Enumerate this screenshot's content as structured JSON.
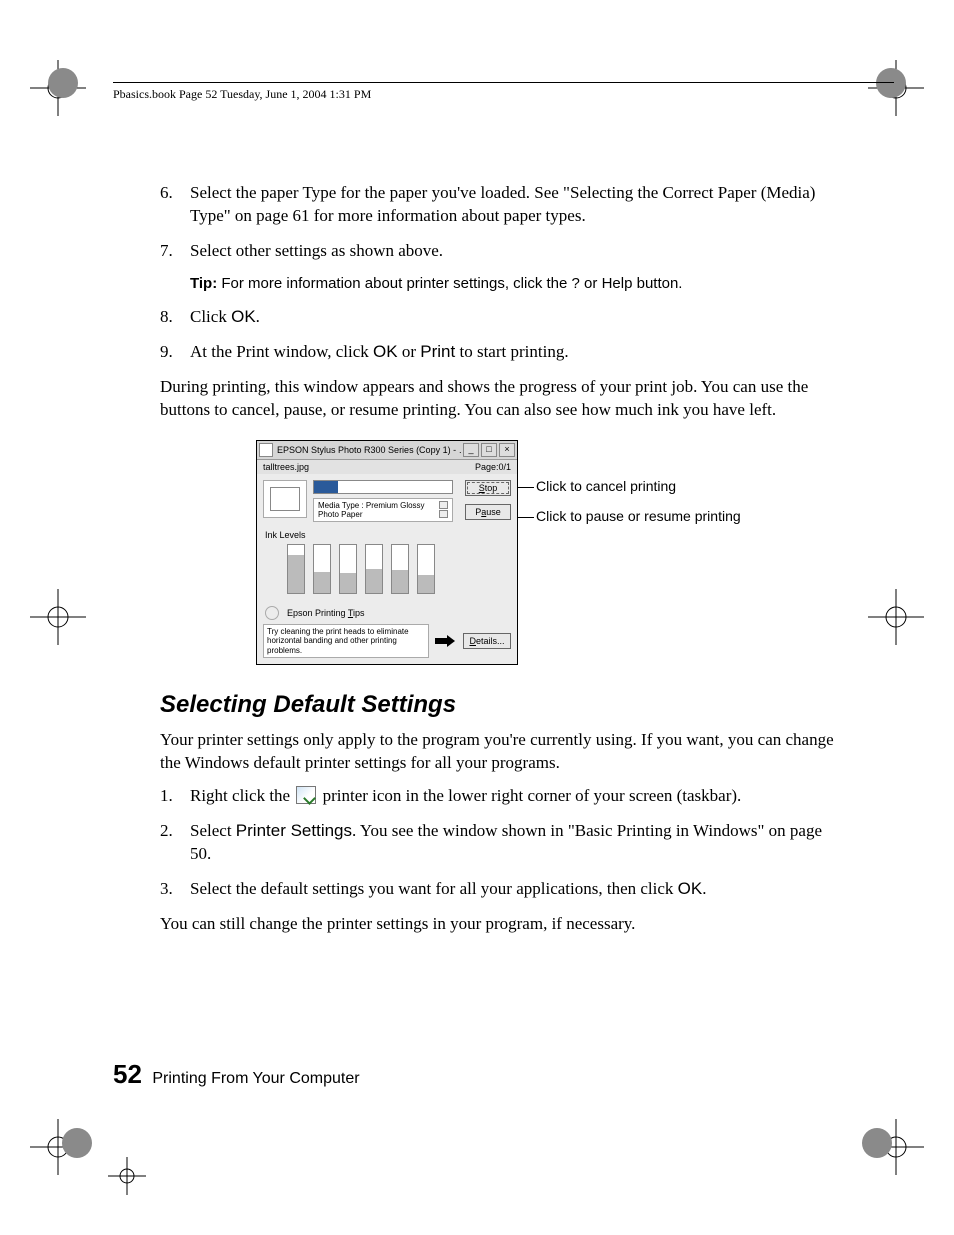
{
  "header": "Pbasics.book  Page 52  Tuesday, June 1, 2004  1:31 PM",
  "steps_a": [
    {
      "n": "6.",
      "t": "Select the paper Type for the paper you've loaded. See \"Selecting the Correct Paper (Media) Type\" on page 61 for more information about paper types."
    },
    {
      "n": "7.",
      "t": "Select other settings as shown above."
    }
  ],
  "tip_label": "Tip:",
  "tip_text": " For more information about printer settings, click the ",
  "tip_q": "?",
  "tip_or": " or ",
  "tip_help": "Help",
  "tip_end": " button.",
  "steps_b": [
    {
      "n": "8.",
      "pre": "Click ",
      "b": "OK",
      "post": "."
    },
    {
      "n": "9.",
      "pre": "At the Print window, click ",
      "b": "OK",
      "mid": " or ",
      "b2": "Print",
      "post": " to start printing."
    }
  ],
  "para1": "During printing, this window appears and shows the progress of your print job. You can use the buttons to cancel, pause, or resume printing. You can also see how much ink you have left.",
  "win": {
    "title": "EPSON Stylus Photo R300 Series (Copy 1) - …",
    "file": "talltrees.jpg",
    "page": "Page:0/1",
    "media": "Media Type : Premium Glossy Photo Paper",
    "stop": "Stop",
    "pause": "Pause",
    "ink": "Ink Levels",
    "tips_label": "Epson Printing Tips",
    "tips_text": "Try cleaning the print heads to eliminate horizontal banding and other printing problems.",
    "details": "Details..."
  },
  "callout1": "Click to cancel printing",
  "callout2": "Click to pause or resume printing",
  "section": "Selecting Default Settings",
  "para2": "Your printer settings only apply to the program you're currently using. If you want, you can change the Windows default printer settings for all your programs.",
  "steps_c": [
    {
      "n": "1.",
      "pre": "Right click the ",
      "post": " printer icon in the lower right corner of your screen (taskbar)."
    },
    {
      "n": "2.",
      "pre": "Select ",
      "b": "Printer Settings",
      "post": ". You see the window shown in \"Basic Printing in Windows\" on page 50."
    },
    {
      "n": "3.",
      "pre": "Select the default settings you want for all your applications, then click ",
      "b": "OK",
      "post": "."
    }
  ],
  "para3": "You can still change the printer settings in your program, if necessary.",
  "footer_page": "52",
  "footer_title": "Printing From Your Computer"
}
